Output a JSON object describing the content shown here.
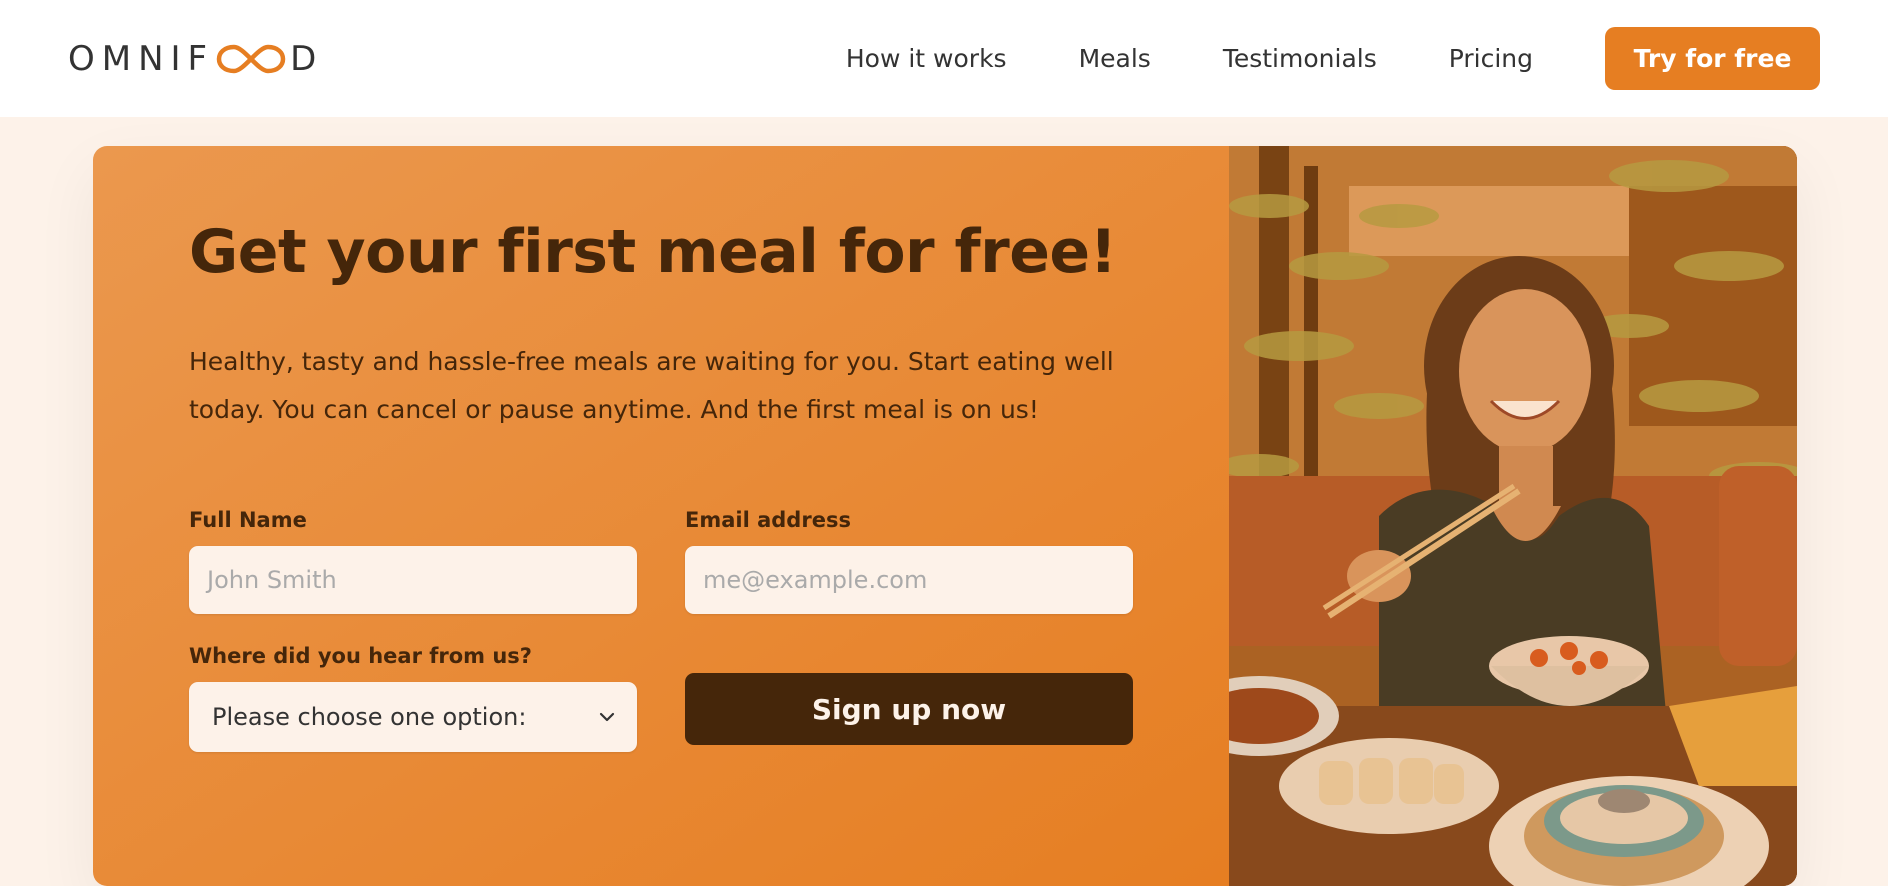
{
  "header": {
    "logo_text_left": "OMNIF",
    "logo_text_right": "D",
    "nav": [
      {
        "label": "How it works"
      },
      {
        "label": "Meals"
      },
      {
        "label": "Testimonials"
      },
      {
        "label": "Pricing"
      }
    ],
    "cta_label": "Try for free"
  },
  "cta": {
    "title": "Get your first meal for free!",
    "description": "Healthy, tasty and hassle-free meals are waiting for you. Start eating well today. You can cancel or pause anytime. And the first meal is on us!",
    "form": {
      "full_name_label": "Full Name",
      "full_name_placeholder": "John Smith",
      "email_label": "Email address",
      "email_placeholder": "me@example.com",
      "source_label": "Where did you hear from us?",
      "source_selected": "Please choose one option:",
      "submit_label": "Sign up now"
    }
  },
  "colors": {
    "primary": "#e67e22",
    "primary_light": "#eb984e",
    "dark": "#45260a",
    "input_bg": "#fdf2e9"
  },
  "image": {
    "icon": "photo-woman-eating-dumplings"
  }
}
